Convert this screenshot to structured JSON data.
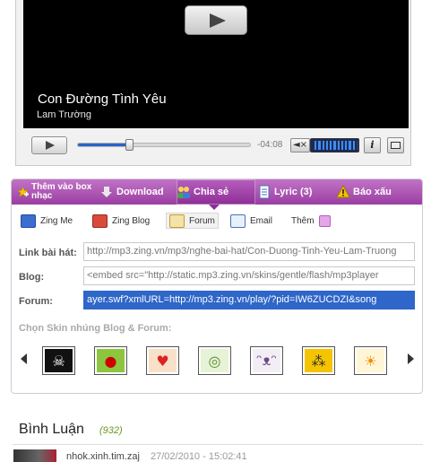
{
  "player": {
    "song_title": "Con Đường Tình Yêu",
    "artist": "Lam Trường",
    "time_remaining": "-04:08",
    "progress_fraction": 0.3,
    "volume_fraction": 0.9,
    "volume_bar_color": "#3d8df5",
    "progress_color": "#2a63c8",
    "icons": [
      "play-icon",
      "mute-icon",
      "info-icon",
      "fullscreen-icon"
    ]
  },
  "tabs": {
    "favorite": "Thêm vào box nhạc",
    "download": "Download",
    "share": "Chia sẻ",
    "lyric": "Lyric (3)",
    "report": "Báo xấu",
    "active": "share",
    "accent_color": "#9a3ea2"
  },
  "share_targets": {
    "zing_me": "Zing Me",
    "zing_blog": "Zing Blog",
    "forum": "Forum",
    "email": "Email",
    "more": "Thêm"
  },
  "fields": {
    "link_label": "Link bài hát:",
    "link_value": "http://mp3.zing.vn/mp3/nghe-bai-hat/Con-Duong-Tinh-Yeu-Lam-Truong",
    "blog_label": "Blog:",
    "blog_value": "<embed src=\"http://static.mp3.zing.vn/skins/gentle/flash/mp3player",
    "forum_label": "Forum:",
    "forum_value": "ayer.swf?xmlURL=http://mp3.zing.vn/play/?pid=IW6ZUCDZI&song"
  },
  "skins": {
    "label": "Chọn Skin nhúng Blog & Forum:",
    "items": [
      "skull",
      "ladybug",
      "hearts",
      "disc",
      "cat",
      "leopard",
      "sun"
    ]
  },
  "comments": {
    "title": "Bình Luận",
    "count": "(932)",
    "first": {
      "user": "nhok.xinh.tim.zaj",
      "time": "27/02/2010 - 15:02:41"
    }
  }
}
